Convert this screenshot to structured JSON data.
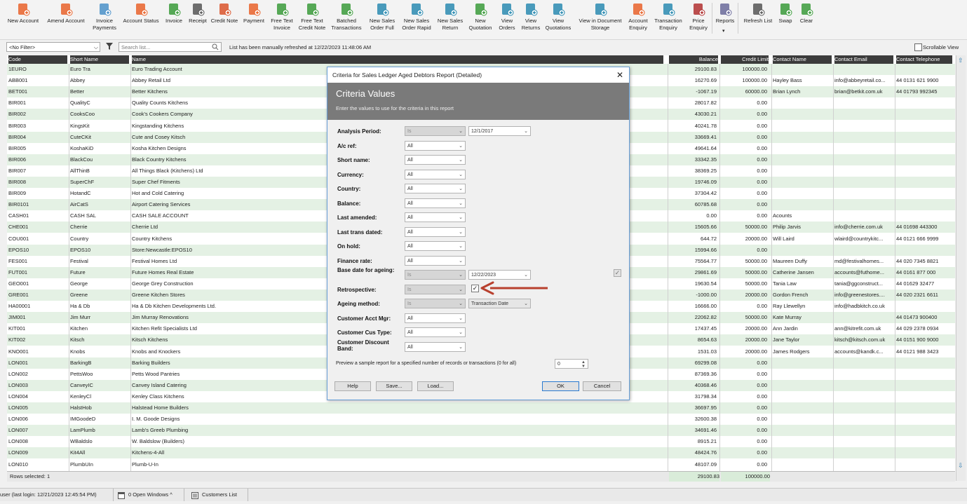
{
  "toolbar": {
    "buttons": [
      {
        "label": "New Account",
        "icon": "person-plus-icon",
        "color": "#e8622a"
      },
      {
        "label": "Amend Account",
        "icon": "person-edit-icon",
        "color": "#e8622a"
      },
      {
        "label": "Invoice Payments",
        "icon": "person-payment-icon",
        "color": "#4a90c8"
      },
      {
        "label": "Account Status",
        "icon": "person-status-icon",
        "color": "#e8622a"
      },
      {
        "label": "Invoice",
        "icon": "invoice-icon",
        "color": "#3a9a3a"
      },
      {
        "label": "Receipt",
        "icon": "bank-icon",
        "color": "#555555"
      },
      {
        "label": "Credit Note",
        "icon": "credit-note-icon",
        "color": "#d9532b"
      },
      {
        "label": "Payment",
        "icon": "payment-icon",
        "color": "#e8622a"
      },
      {
        "label": "Free Text Invoice",
        "icon": "free-text-invoice-icon",
        "color": "#3a9a3a"
      },
      {
        "label": "Free Text Credit Note",
        "icon": "free-text-credit-icon",
        "color": "#3a9a3a"
      },
      {
        "label": "Batched Transactions",
        "icon": "batch-icon",
        "color": "#3a9a3a"
      },
      {
        "label": "New Sales Order Full",
        "icon": "sales-order-icon",
        "color": "#2a8ab0"
      },
      {
        "label": "New Sales Order Rapid",
        "icon": "sales-order-rapid-icon",
        "color": "#2a8ab0"
      },
      {
        "label": "New Sales Return",
        "icon": "sales-return-icon",
        "color": "#2a8ab0"
      },
      {
        "label": "New Quotation",
        "icon": "quotation-icon",
        "color": "#3a9a3a"
      },
      {
        "label": "View Orders",
        "icon": "view-orders-icon",
        "color": "#2a8ab0"
      },
      {
        "label": "View Returns",
        "icon": "view-returns-icon",
        "color": "#2a8ab0"
      },
      {
        "label": "View Quotations",
        "icon": "view-quotations-icon",
        "color": "#2a8ab0"
      },
      {
        "label": "View in Document Storage",
        "icon": "document-storage-icon",
        "color": "#2a8ab0"
      },
      {
        "label": "Account Enquiry",
        "icon": "account-enquiry-icon",
        "color": "#e8622a"
      },
      {
        "label": "Transaction Enquiry",
        "icon": "transaction-enquiry-icon",
        "color": "#2a8ab0"
      },
      {
        "label": "Price Enquiry",
        "icon": "price-enquiry-icon",
        "color": "#b03030"
      },
      {
        "label": "Reports",
        "icon": "reports-icon",
        "color": "#6a6a9a"
      },
      {
        "label": "Refresh List",
        "icon": "refresh-icon",
        "color": "#555555"
      },
      {
        "label": "Swap",
        "icon": "swap-icon",
        "color": "#3a9a3a"
      },
      {
        "label": "Clear",
        "icon": "clear-icon",
        "color": "#3a9a3a"
      }
    ]
  },
  "filter": {
    "selected": "<No Filter>",
    "search_placeholder": "Search list...",
    "refresh_message": "List has been manually refreshed at 12/22/2023 11:48:06 AM",
    "scrollable_view": "Scrollable View"
  },
  "grid": {
    "columns": [
      "Code",
      "Short Name",
      "Name",
      "Balance",
      "Credit Limit",
      "Contact Name",
      "Contact Email",
      "Contact Telephone"
    ],
    "rows": [
      [
        "1EURO",
        "Euro Tra",
        "Euro Trading Account",
        "29100.83",
        "100000.00",
        "",
        "",
        ""
      ],
      [
        "ABB001",
        "Abbey",
        "Abbey Retail Ltd",
        "16270.69",
        "100000.00",
        "Hayley Bass",
        "info@abbeyretail.co...",
        "44 0131 621 9900"
      ],
      [
        "BET001",
        "Better",
        "Better Kitchens",
        "-1067.19",
        "60000.00",
        "Brian Lynch",
        "brian@betkit.com.uk",
        "44 01793 992345"
      ],
      [
        "BIR001",
        "QualityC",
        "Quality Counts Kitchens",
        "28017.82",
        "0.00",
        "",
        "",
        ""
      ],
      [
        "BIR002",
        "CooksCoo",
        "Cook's Cookers Company",
        "43030.21",
        "0.00",
        "",
        "",
        ""
      ],
      [
        "BIR003",
        "KingsKit",
        "Kingstanding Kitchens",
        "40241.78",
        "0.00",
        "",
        "",
        ""
      ],
      [
        "BIR004",
        "CuteCKit",
        "Cute and Cosey Kitsch",
        "33669.41",
        "0.00",
        "",
        "",
        ""
      ],
      [
        "BIR005",
        "KoshaKiD",
        "Kosha Kitchen Designs",
        "49641.64",
        "0.00",
        "",
        "",
        ""
      ],
      [
        "BIR006",
        "BlackCou",
        "Black Country Kitchens",
        "33342.35",
        "0.00",
        "",
        "",
        ""
      ],
      [
        "BIR007",
        "AllThinB",
        "All Things Black (Kitchens) Ltd",
        "38369.25",
        "0.00",
        "",
        "",
        ""
      ],
      [
        "BIR008",
        "SuperChF",
        "Super Chef Fitments",
        "19746.09",
        "0.00",
        "",
        "",
        ""
      ],
      [
        "BIR009",
        "HotandC",
        "Hot and Cold Catering",
        "37304.42",
        "0.00",
        "",
        "",
        ""
      ],
      [
        "BIR0101",
        "AirCatS",
        "Airport Catering Services",
        "60785.68",
        "0.00",
        "",
        "",
        ""
      ],
      [
        "CASH01",
        "CASH SAL",
        "CASH SALE ACCOUNT",
        "0.00",
        "0.00",
        "Acounts",
        "",
        ""
      ],
      [
        "CHE001",
        "Cherrie",
        "Cherrie Ltd",
        "15605.66",
        "50000.00",
        "Philip Jarvis",
        "info@cherrie.com.uk",
        "44 01698 443300"
      ],
      [
        "COU001",
        "Country",
        "Country Kitchens",
        "644.72",
        "20000.00",
        "Will Laird",
        "wlaird@countrykitc...",
        "44 0121 666 9999"
      ],
      [
        "EPOS10",
        "EPOS10",
        "Store:Newcastle:EPOS10",
        "15994.66",
        "0.00",
        "",
        "",
        ""
      ],
      [
        "FES001",
        "Festival",
        "Festival Homes Ltd",
        "75564.77",
        "50000.00",
        "Maureen Duffy",
        "md@festivalhomes...",
        "44 020 7345 8821"
      ],
      [
        "FUT001",
        "Future",
        "Future Homes Real Estate",
        "29861.69",
        "50000.00",
        "Catherine Jansen",
        "accounts@futhome...",
        "44 0161 877 000"
      ],
      [
        "GEO001",
        "George",
        "George Grey Construction",
        "19630.54",
        "50000.00",
        "Tania Law",
        "tania@ggconstruct...",
        "44 01629 32477"
      ],
      [
        "GRE001",
        "Greene",
        "Greene Kitchen Stores",
        "-1000.00",
        "20000.00",
        "Gordon French",
        "info@greenestores....",
        "44 020 2321 6611"
      ],
      [
        "HA00001",
        "Ha & Db",
        "Ha & Db Kitchen Developments Ltd.",
        "16666.00",
        "0.00",
        "Ray Llewellyn",
        "info@hadbkitch.co.uk",
        ""
      ],
      [
        "JIM001",
        "Jim Murr",
        "Jim Murray Renovations",
        "22062.82",
        "50000.00",
        "Kate Murray",
        "",
        "44 01473 900400"
      ],
      [
        "KIT001",
        "Kitchen",
        "Kitchen Refit Specialists Ltd",
        "17437.45",
        "20000.00",
        "Ann Jardin",
        "ann@kitrefit.com.uk",
        "44 029 2378 0934"
      ],
      [
        "KIT002",
        "Kitsch",
        "Kitsch Kitchens",
        "8654.63",
        "20000.00",
        "Jane Taylor",
        "kitsch@kitsch.com.uk",
        "44 0151 900 9000"
      ],
      [
        "KNO001",
        "Knobs",
        "Knobs and Knockers",
        "1531.03",
        "20000.00",
        "James Rodgers",
        "accounts@kandk.c...",
        "44 0121 988 3423"
      ],
      [
        "LON001",
        "BarkingB",
        "Barking Builders",
        "69299.08",
        "0.00",
        "",
        "",
        ""
      ],
      [
        "LON002",
        "PettsWoo",
        "Petts Wood Pantries",
        "87369.36",
        "0.00",
        "",
        "",
        ""
      ],
      [
        "LON003",
        "CanveyIC",
        "Canvey Island Catering",
        "40368.46",
        "0.00",
        "",
        "",
        ""
      ],
      [
        "LON004",
        "KenleyCl",
        "Kenley Class Kitchens",
        "31798.34",
        "0.00",
        "",
        "",
        ""
      ],
      [
        "LON005",
        "HalstHob",
        "Halstead Home Builders",
        "36697.95",
        "0.00",
        "",
        "",
        ""
      ],
      [
        "LON006",
        "IMGoodeD",
        "I. M. Goode Designs",
        "32600.38",
        "0.00",
        "",
        "",
        ""
      ],
      [
        "LON007",
        "LamPlumb",
        "Lamb's Greeb Plumbing",
        "34691.46",
        "0.00",
        "",
        "",
        ""
      ],
      [
        "LON008",
        "WBaldslo",
        "W. Baldslow (Builders)",
        "8915.21",
        "0.00",
        "",
        "",
        ""
      ],
      [
        "LON009",
        "Kit4All",
        "Kitchens-4-All",
        "48424.76",
        "0.00",
        "",
        "",
        ""
      ],
      [
        "LON010",
        "PlumbUIn",
        "Plumb-U-In",
        "48107.09",
        "0.00",
        "",
        "",
        ""
      ]
    ],
    "rows_selected": "Rows selected: 1",
    "total_balance": "29100.83",
    "total_credit": "100000.00"
  },
  "status": {
    "login": "user (last login: 12/21/2023 12:45:54 PM)",
    "open_windows": "0 Open Windows ^",
    "customers_list": "Customers List"
  },
  "dialog": {
    "title": "Criteria for Sales Ledger Aged Debtors Report (Detailed)",
    "heading": "Criteria Values",
    "subheading": "Enter the values to use for the criteria in this report",
    "criteria": [
      {
        "label": "Analysis Period:",
        "op": "Is",
        "op_disabled": true,
        "value": "12/1/2017"
      },
      {
        "label": "A/c ref:",
        "op": "All",
        "op_disabled": false,
        "value": ""
      },
      {
        "label": "Short name:",
        "op": "All",
        "op_disabled": false,
        "value": ""
      },
      {
        "label": "Currency:",
        "op": "All",
        "op_disabled": false,
        "value": ""
      },
      {
        "label": "Country:",
        "op": "All",
        "op_disabled": false,
        "value": ""
      },
      {
        "label": "Balance:",
        "op": "All",
        "op_disabled": false,
        "value": ""
      },
      {
        "label": "Last amended:",
        "op": "All",
        "op_disabled": false,
        "value": ""
      },
      {
        "label": "Last trans dated:",
        "op": "All",
        "op_disabled": false,
        "value": ""
      },
      {
        "label": "On hold:",
        "op": "All",
        "op_disabled": false,
        "value": ""
      },
      {
        "label": "Finance rate:",
        "op": "All",
        "op_disabled": false,
        "value": ""
      },
      {
        "label": "Base date for ageing:",
        "op": "Is",
        "op_disabled": true,
        "value": "12/22/2023"
      },
      {
        "label": "Retrospective:",
        "op": "Is",
        "op_disabled": true,
        "value": ""
      },
      {
        "label": "Ageing method:",
        "op": "Is",
        "op_disabled": true,
        "value": "Transaction Date"
      },
      {
        "label": "Customer Acct Mgr:",
        "op": "All",
        "op_disabled": false,
        "value": ""
      },
      {
        "label": "Customer Cus Type:",
        "op": "All",
        "op_disabled": false,
        "value": ""
      },
      {
        "label": "Customer Discount Band:",
        "op": "All",
        "op_disabled": false,
        "value": ""
      }
    ],
    "retrospective_checked": true,
    "base_date_checked": true,
    "preview_label": "Preview a sample report for a specified number of records or transactions (0 for all)",
    "preview_value": "0",
    "help": "Help",
    "save": "Save...",
    "load": "Load...",
    "ok": "OK",
    "cancel": "Cancel"
  },
  "colors": {
    "accent": "#e8622a",
    "row_alt": "#e4f1e4",
    "header_bg": "#3b3b3b",
    "arrow": "#b8402e"
  }
}
